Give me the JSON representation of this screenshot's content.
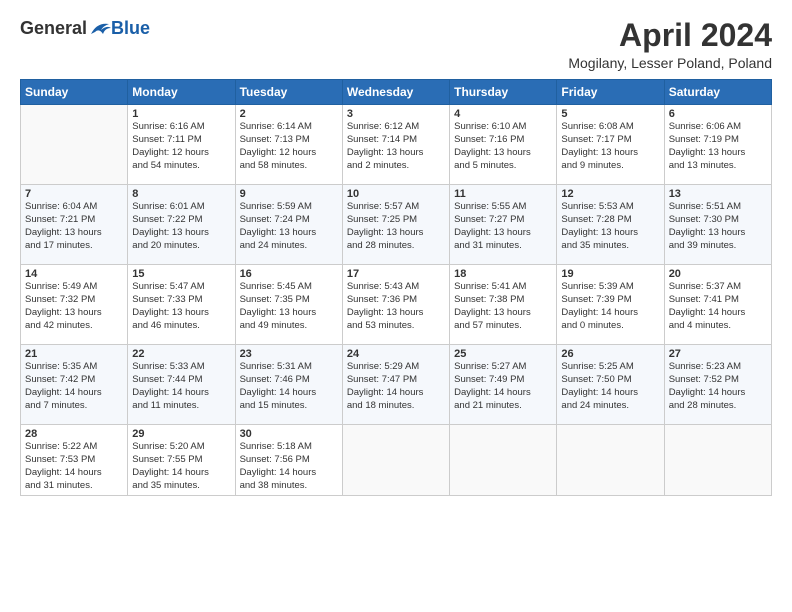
{
  "logo": {
    "general": "General",
    "blue": "Blue"
  },
  "title": "April 2024",
  "subtitle": "Mogilany, Lesser Poland, Poland",
  "weekdays": [
    "Sunday",
    "Monday",
    "Tuesday",
    "Wednesday",
    "Thursday",
    "Friday",
    "Saturday"
  ],
  "weeks": [
    [
      {
        "day": "",
        "info": ""
      },
      {
        "day": "1",
        "info": "Sunrise: 6:16 AM\nSunset: 7:11 PM\nDaylight: 12 hours\nand 54 minutes."
      },
      {
        "day": "2",
        "info": "Sunrise: 6:14 AM\nSunset: 7:13 PM\nDaylight: 12 hours\nand 58 minutes."
      },
      {
        "day": "3",
        "info": "Sunrise: 6:12 AM\nSunset: 7:14 PM\nDaylight: 13 hours\nand 2 minutes."
      },
      {
        "day": "4",
        "info": "Sunrise: 6:10 AM\nSunset: 7:16 PM\nDaylight: 13 hours\nand 5 minutes."
      },
      {
        "day": "5",
        "info": "Sunrise: 6:08 AM\nSunset: 7:17 PM\nDaylight: 13 hours\nand 9 minutes."
      },
      {
        "day": "6",
        "info": "Sunrise: 6:06 AM\nSunset: 7:19 PM\nDaylight: 13 hours\nand 13 minutes."
      }
    ],
    [
      {
        "day": "7",
        "info": "Sunrise: 6:04 AM\nSunset: 7:21 PM\nDaylight: 13 hours\nand 17 minutes."
      },
      {
        "day": "8",
        "info": "Sunrise: 6:01 AM\nSunset: 7:22 PM\nDaylight: 13 hours\nand 20 minutes."
      },
      {
        "day": "9",
        "info": "Sunrise: 5:59 AM\nSunset: 7:24 PM\nDaylight: 13 hours\nand 24 minutes."
      },
      {
        "day": "10",
        "info": "Sunrise: 5:57 AM\nSunset: 7:25 PM\nDaylight: 13 hours\nand 28 minutes."
      },
      {
        "day": "11",
        "info": "Sunrise: 5:55 AM\nSunset: 7:27 PM\nDaylight: 13 hours\nand 31 minutes."
      },
      {
        "day": "12",
        "info": "Sunrise: 5:53 AM\nSunset: 7:28 PM\nDaylight: 13 hours\nand 35 minutes."
      },
      {
        "day": "13",
        "info": "Sunrise: 5:51 AM\nSunset: 7:30 PM\nDaylight: 13 hours\nand 39 minutes."
      }
    ],
    [
      {
        "day": "14",
        "info": "Sunrise: 5:49 AM\nSunset: 7:32 PM\nDaylight: 13 hours\nand 42 minutes."
      },
      {
        "day": "15",
        "info": "Sunrise: 5:47 AM\nSunset: 7:33 PM\nDaylight: 13 hours\nand 46 minutes."
      },
      {
        "day": "16",
        "info": "Sunrise: 5:45 AM\nSunset: 7:35 PM\nDaylight: 13 hours\nand 49 minutes."
      },
      {
        "day": "17",
        "info": "Sunrise: 5:43 AM\nSunset: 7:36 PM\nDaylight: 13 hours\nand 53 minutes."
      },
      {
        "day": "18",
        "info": "Sunrise: 5:41 AM\nSunset: 7:38 PM\nDaylight: 13 hours\nand 57 minutes."
      },
      {
        "day": "19",
        "info": "Sunrise: 5:39 AM\nSunset: 7:39 PM\nDaylight: 14 hours\nand 0 minutes."
      },
      {
        "day": "20",
        "info": "Sunrise: 5:37 AM\nSunset: 7:41 PM\nDaylight: 14 hours\nand 4 minutes."
      }
    ],
    [
      {
        "day": "21",
        "info": "Sunrise: 5:35 AM\nSunset: 7:42 PM\nDaylight: 14 hours\nand 7 minutes."
      },
      {
        "day": "22",
        "info": "Sunrise: 5:33 AM\nSunset: 7:44 PM\nDaylight: 14 hours\nand 11 minutes."
      },
      {
        "day": "23",
        "info": "Sunrise: 5:31 AM\nSunset: 7:46 PM\nDaylight: 14 hours\nand 15 minutes."
      },
      {
        "day": "24",
        "info": "Sunrise: 5:29 AM\nSunset: 7:47 PM\nDaylight: 14 hours\nand 18 minutes."
      },
      {
        "day": "25",
        "info": "Sunrise: 5:27 AM\nSunset: 7:49 PM\nDaylight: 14 hours\nand 21 minutes."
      },
      {
        "day": "26",
        "info": "Sunrise: 5:25 AM\nSunset: 7:50 PM\nDaylight: 14 hours\nand 24 minutes."
      },
      {
        "day": "27",
        "info": "Sunrise: 5:23 AM\nSunset: 7:52 PM\nDaylight: 14 hours\nand 28 minutes."
      }
    ],
    [
      {
        "day": "28",
        "info": "Sunrise: 5:22 AM\nSunset: 7:53 PM\nDaylight: 14 hours\nand 31 minutes."
      },
      {
        "day": "29",
        "info": "Sunrise: 5:20 AM\nSunset: 7:55 PM\nDaylight: 14 hours\nand 35 minutes."
      },
      {
        "day": "30",
        "info": "Sunrise: 5:18 AM\nSunset: 7:56 PM\nDaylight: 14 hours\nand 38 minutes."
      },
      {
        "day": "",
        "info": ""
      },
      {
        "day": "",
        "info": ""
      },
      {
        "day": "",
        "info": ""
      },
      {
        "day": "",
        "info": ""
      }
    ]
  ]
}
